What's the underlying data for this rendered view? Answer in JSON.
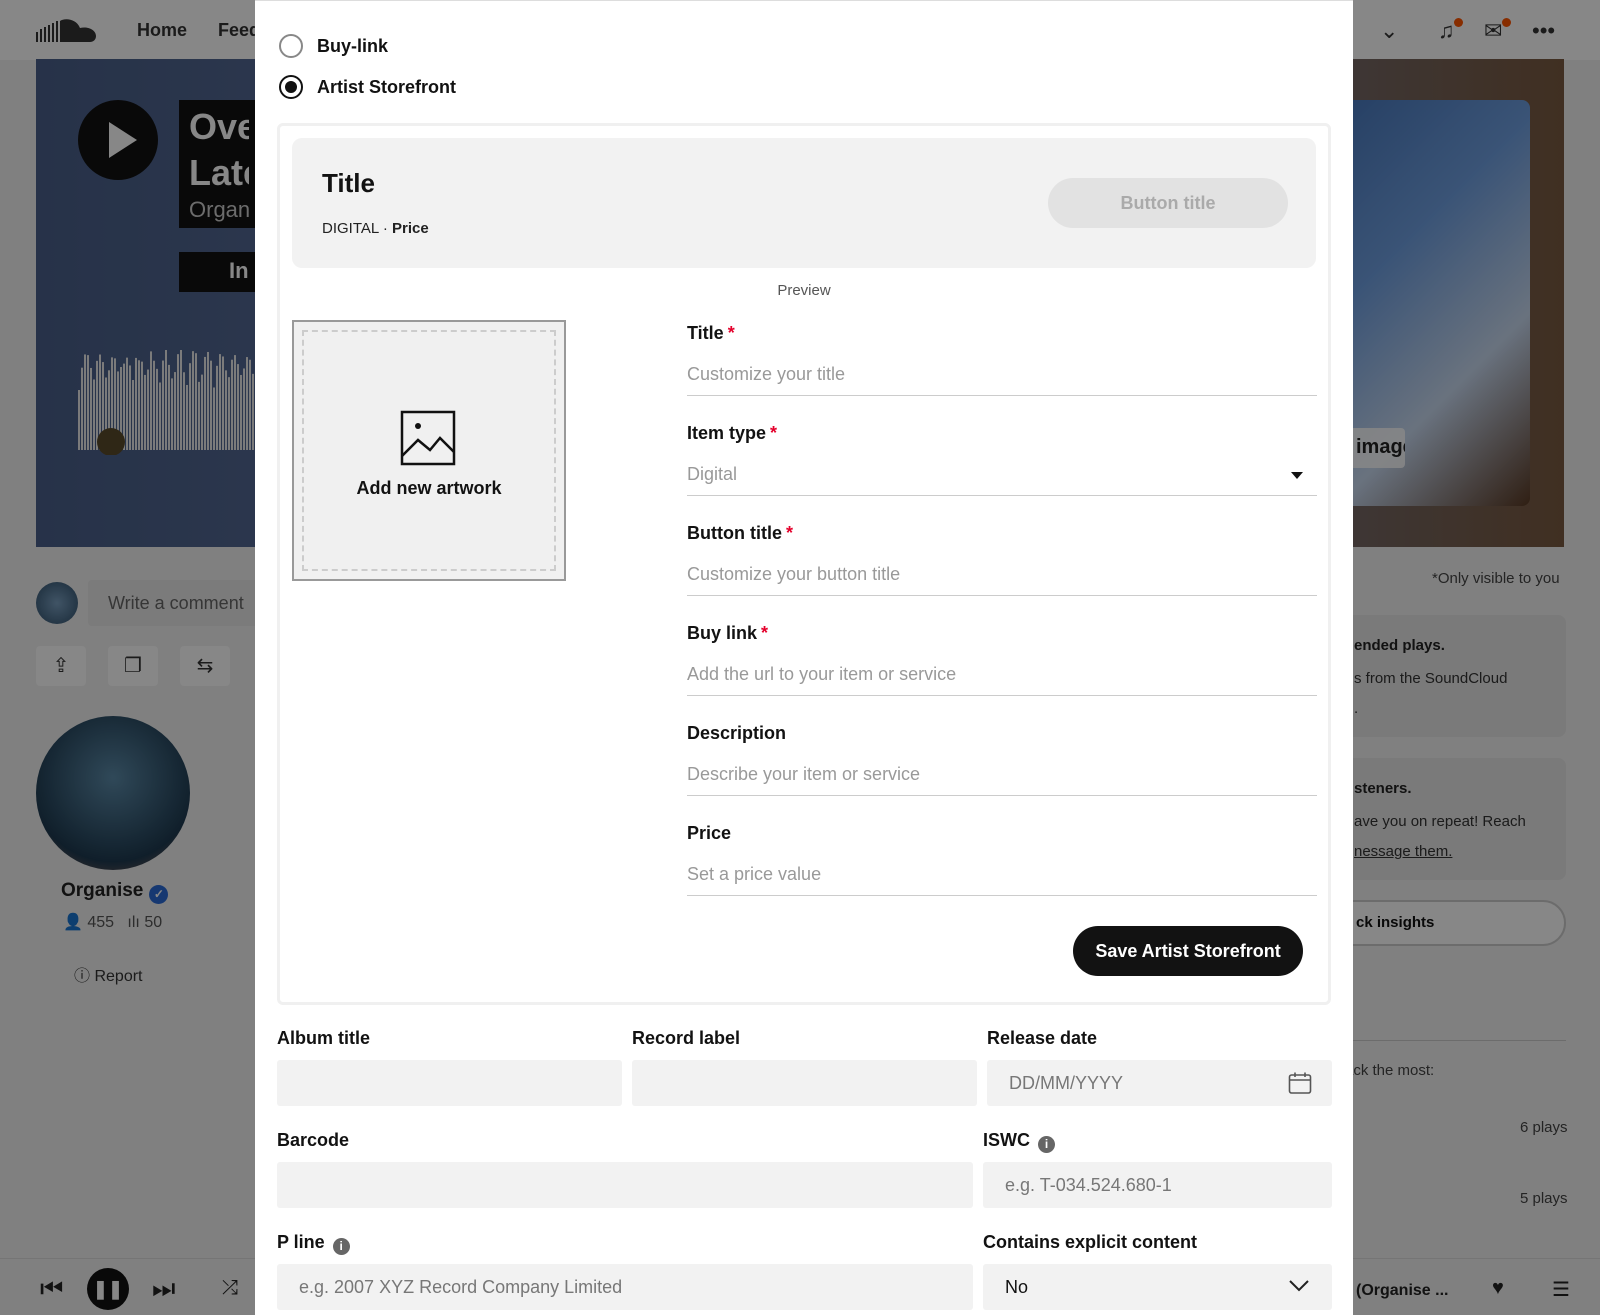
{
  "background": {
    "nav": {
      "home": "Home",
      "feed": "Feed"
    },
    "hero": {
      "title_lines": [
        "Over",
        "Late"
      ],
      "artist": "Organise",
      "tag": "In",
      "art_tag": "image"
    },
    "comment_placeholder": "Write a comment",
    "artist": {
      "name": "Organise",
      "followers": "455",
      "tracks": "50",
      "report": "Report"
    },
    "right_panel": {
      "visibility_note": "*Only visible to you",
      "card1_title": "ended plays.",
      "card1_text_lines": [
        "s from the SoundCloud",
        "."
      ],
      "card2_title": "steners.",
      "card2_text_lines": [
        "ave you on repeat! Reach",
        "nessage them."
      ],
      "insights_button": "ck insights",
      "most_text": "rack the most:",
      "plays": [
        "6 plays",
        "5 plays"
      ]
    },
    "player": {
      "track": "(Organise ..."
    }
  },
  "modal": {
    "link_types": [
      {
        "label": "Buy-link",
        "checked": false
      },
      {
        "label": "Artist Storefront",
        "checked": true
      }
    ],
    "preview": {
      "title": "Title",
      "type": "DIGITAL",
      "separator": "·",
      "price": "Price",
      "button": "Button title",
      "caption": "Preview"
    },
    "artwork_label": "Add new artwork",
    "fields": [
      {
        "label": "Title",
        "required": true,
        "placeholder": "Customize your title"
      },
      {
        "label": "Item type",
        "required": true,
        "placeholder": "Digital",
        "dropdown": true
      },
      {
        "label": "Button title",
        "required": true,
        "placeholder": "Customize your button title"
      },
      {
        "label": "Buy link",
        "required": true,
        "placeholder": "Add the url to your item or service"
      },
      {
        "label": "Description",
        "required": false,
        "placeholder": "Describe your item or service"
      },
      {
        "label": "Price",
        "required": false,
        "placeholder": "Set a price value"
      }
    ],
    "required_mark": "*",
    "save_button": "Save Artist Storefront",
    "metadata": {
      "album_title": {
        "label": "Album title",
        "value": ""
      },
      "record_label": {
        "label": "Record label",
        "value": ""
      },
      "release_date": {
        "label": "Release date",
        "placeholder": "DD/MM/YYYY"
      },
      "barcode": {
        "label": "Barcode",
        "value": ""
      },
      "iswc": {
        "label": "ISWC",
        "placeholder": "e.g. T-034.524.680-1"
      },
      "p_line": {
        "label": "P line",
        "placeholder": "e.g. 2007 XYZ Record Company Limited"
      },
      "explicit": {
        "label": "Contains explicit content",
        "value": "No"
      }
    },
    "info_glyph": "i"
  },
  "colors": {
    "required": "#e4002b",
    "primary_button": "#121212",
    "accent": "#ff5500",
    "verified": "#2a6bd6"
  }
}
